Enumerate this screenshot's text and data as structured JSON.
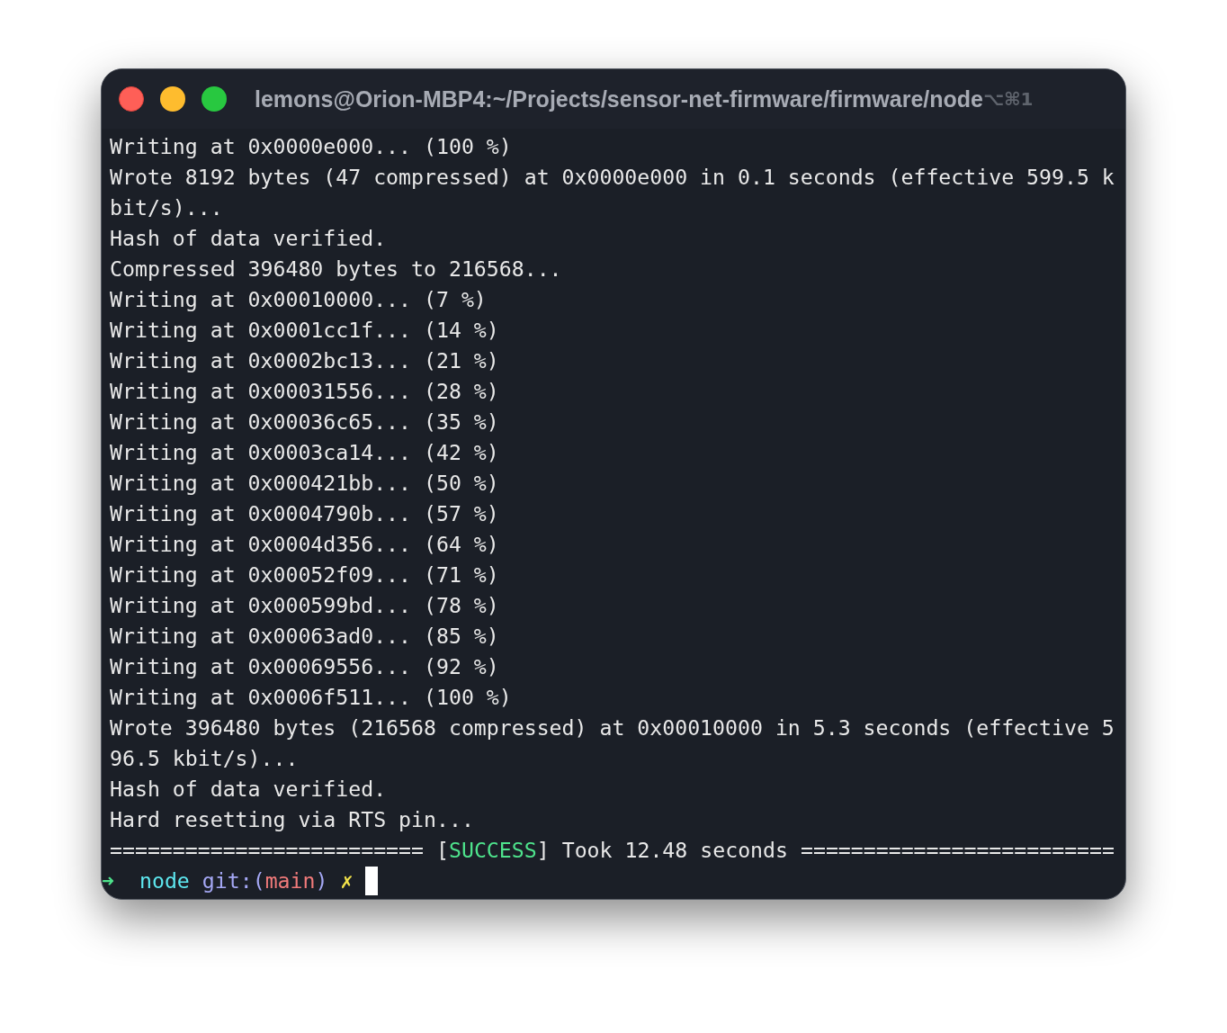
{
  "window": {
    "title": "lemons@Orion-MBP4:~/Projects/sensor-net-firmware/firmware/node",
    "shortcut": "⌥⌘1"
  },
  "output": [
    "Writing at 0x0000e000... (100 %)",
    "Wrote 8192 bytes (47 compressed) at 0x0000e000 in 0.1 seconds (effective 599.5 k",
    "bit/s)...",
    "Hash of data verified.",
    "Compressed 396480 bytes to 216568...",
    "Writing at 0x00010000... (7 %)",
    "Writing at 0x0001cc1f... (14 %)",
    "Writing at 0x0002bc13... (21 %)",
    "Writing at 0x00031556... (28 %)",
    "Writing at 0x00036c65... (35 %)",
    "Writing at 0x0003ca14... (42 %)",
    "Writing at 0x000421bb... (50 %)",
    "Writing at 0x0004790b... (57 %)",
    "Writing at 0x0004d356... (64 %)",
    "Writing at 0x00052f09... (71 %)",
    "Writing at 0x000599bd... (78 %)",
    "Writing at 0x00063ad0... (85 %)",
    "Writing at 0x00069556... (92 %)",
    "Writing at 0x0006f511... (100 %)",
    "Wrote 396480 bytes (216568 compressed) at 0x00010000 in 5.3 seconds (effective 5",
    "96.5 kbit/s)...",
    "Hash of data verified.",
    "Hard resetting via RTS pin..."
  ],
  "banner": {
    "left": "=========================",
    "open": "[",
    "status": "SUCCESS",
    "close": "]",
    "message": "Took 12.48 seconds",
    "right": "========================="
  },
  "prompt": [
    {
      "kind": "arrow",
      "text": "➜"
    },
    {
      "kind": "dir",
      "text": "node"
    },
    {
      "kind": "git",
      "text": "git:("
    },
    {
      "kind": "branch",
      "text": "main"
    },
    {
      "kind": "git",
      "text": ")"
    },
    {
      "kind": "dirty",
      "text": "✗"
    }
  ]
}
